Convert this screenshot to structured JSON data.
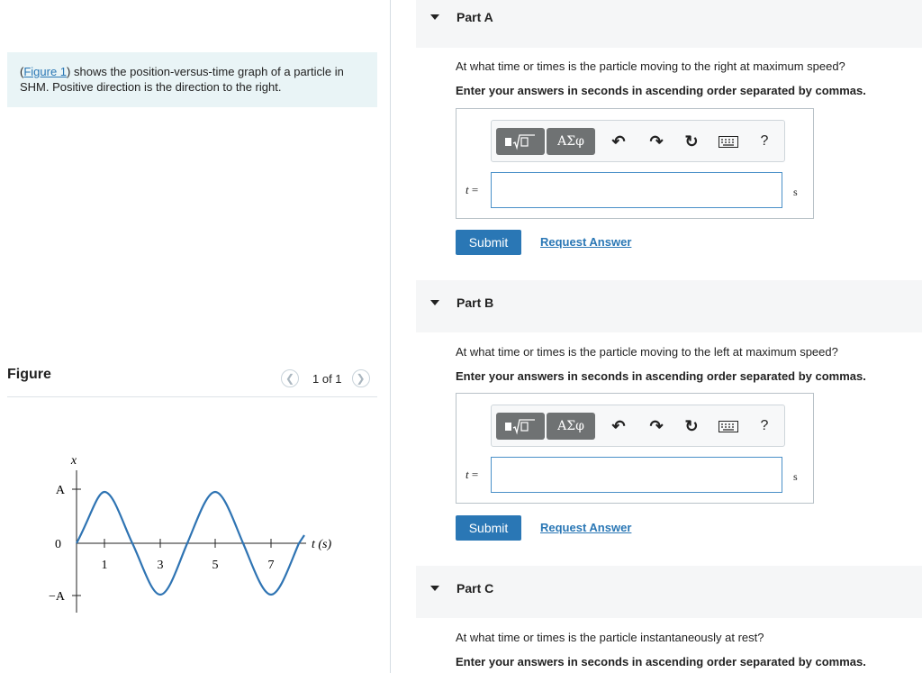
{
  "intro": {
    "figure_link": "Figure 1",
    "text_after_link": ") shows the position-versus-time graph of a particle in SHM. Positive direction is the direction to the right.",
    "open_paren": "("
  },
  "figure": {
    "title": "Figure",
    "pager": "1 of 1",
    "prev_icon": "chevron-left-icon",
    "next_icon": "chevron-right-icon",
    "graph": {
      "y_axis_label": "x",
      "x_axis_label": "t (s)",
      "y_ticks": [
        "A",
        "0",
        "−A"
      ],
      "x_ticks": [
        "1",
        "3",
        "5",
        "7"
      ]
    }
  },
  "toolbar": {
    "math_label": "√□",
    "greek_label": "AΣφ",
    "undo_icon": "undo-icon",
    "redo_icon": "redo-icon",
    "reset_icon": "reset-icon",
    "keyboard_icon": "keyboard-icon",
    "help_label": "?"
  },
  "parts": [
    {
      "label": "Part A",
      "question": "At what time or times is the particle moving to the right at maximum speed?",
      "instruction": "Enter your answers in seconds in ascending order separated by commas.",
      "var": "t",
      "equals": " =",
      "value": "",
      "unit": "s",
      "submit": "Submit",
      "request": "Request Answer"
    },
    {
      "label": "Part B",
      "question": "At what time or times is the particle moving to the left at maximum speed?",
      "instruction": "Enter your answers in seconds in ascending order separated by commas.",
      "var": "t",
      "equals": " =",
      "value": "",
      "unit": "s",
      "submit": "Submit",
      "request": "Request Answer"
    },
    {
      "label": "Part C",
      "question": "At what time or times is the particle instantaneously at rest?",
      "instruction": "Enter your answers in seconds in ascending order separated by commas."
    }
  ],
  "colors": {
    "accent": "#2a77b5",
    "curve": "#2f74b3",
    "intro_bg": "#e9f4f6"
  }
}
